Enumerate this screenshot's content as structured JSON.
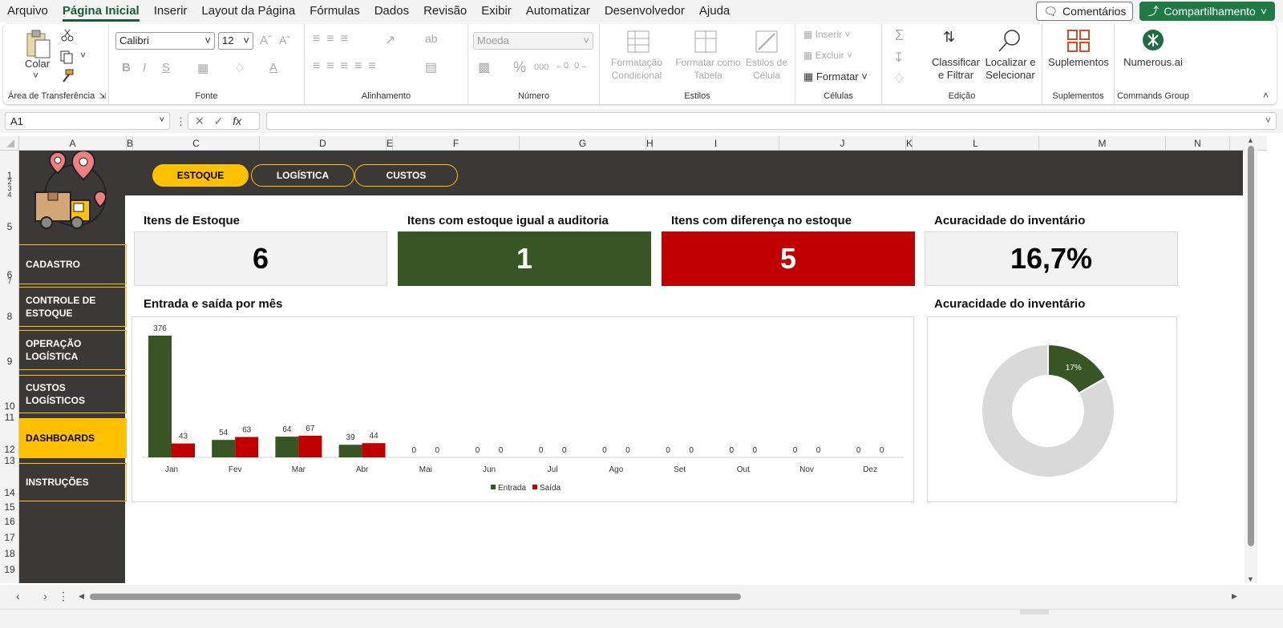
{
  "menu": {
    "tabs": [
      "Arquivo",
      "Página Inicial",
      "Inserir",
      "Layout da Página",
      "Fórmulas",
      "Dados",
      "Revisão",
      "Exibir",
      "Automatizar",
      "Desenvolvedor",
      "Ajuda"
    ],
    "comments": "Comentários",
    "share": "Compartilhamento"
  },
  "ribbon": {
    "clipboard": {
      "paste": "Colar",
      "label": "Área de Transferência"
    },
    "font": {
      "name": "Calibri",
      "size": "12",
      "label": "Fonte"
    },
    "alignment": {
      "label": "Alinhamento"
    },
    "number": {
      "format": "Moeda",
      "label": "Número"
    },
    "styles": {
      "conditional": "Formatação Condicional",
      "table": "Formatar como Tabela",
      "cell": "Estilos de Célula",
      "label": "Estilos"
    },
    "cells": {
      "insert": "Inserir",
      "delete": "Excluir",
      "format": "Formatar",
      "label": "Células"
    },
    "editing": {
      "sort": "Classificar e Filtrar",
      "find": "Localizar e Selecionar",
      "label": "Edição"
    },
    "addins": {
      "btn": "Suplementos",
      "label": "Suplementos"
    },
    "commands": {
      "btn": "Numerous.ai",
      "label": "Commands Group"
    }
  },
  "formula": {
    "namebox": "A1",
    "fx": "fx",
    "content": ""
  },
  "columns": [
    "A",
    "B",
    "C",
    "D",
    "E",
    "F",
    "G",
    "H",
    "I",
    "J",
    "K",
    "L",
    "M",
    "N"
  ],
  "rows": [
    "1",
    "2",
    "3",
    "4",
    "5",
    "6",
    "7",
    "8",
    "9",
    "10",
    "11",
    "12",
    "13",
    "14",
    "15",
    "16",
    "17",
    "18",
    "19"
  ],
  "dashboard": {
    "tabs": [
      "ESTOQUE",
      "LOGÍSTICA",
      "CUSTOS"
    ],
    "nav": [
      "CADASTRO",
      "CONTROLE DE ESTOQUE",
      "OPERAÇÃO LOGÍSTICA",
      "CUSTOS LOGÍSTICOS",
      "DASHBOARDS",
      "INSTRUÇÕES"
    ],
    "kpis": [
      {
        "title": "Itens de Estoque",
        "value": "6",
        "bg": "#f2f2f2",
        "fg": "#000000"
      },
      {
        "title": "Itens com estoque igual a auditoria",
        "value": "1",
        "bg": "#375623",
        "fg": "#ffffff"
      },
      {
        "title": "Itens com diferença no estoque",
        "value": "5",
        "bg": "#c00000",
        "fg": "#ffffff"
      },
      {
        "title": "Acuracidade do inventário",
        "value": "16,7%",
        "bg": "#f2f2f2",
        "fg": "#000000"
      }
    ],
    "bar_title": "Entrada e saída por mês",
    "donut_title": "Acuracidade do inventário"
  },
  "chart_data": [
    {
      "type": "bar",
      "title": "Entrada e saída por mês",
      "categories": [
        "Jan",
        "Fev",
        "Mar",
        "Abr",
        "Mai",
        "Jun",
        "Jul",
        "Ago",
        "Set",
        "Out",
        "Nov",
        "Dez"
      ],
      "series": [
        {
          "name": "Entrada",
          "values": [
            376,
            54,
            64,
            39,
            0,
            0,
            0,
            0,
            0,
            0,
            0,
            0
          ],
          "color": "#375623"
        },
        {
          "name": "Saída",
          "values": [
            43,
            63,
            67,
            44,
            0,
            0,
            0,
            0,
            0,
            0,
            0,
            0
          ],
          "color": "#c00000"
        }
      ],
      "ylim": [
        0,
        376
      ],
      "grid": false,
      "legend": "bottom"
    },
    {
      "type": "pie",
      "title": "Acuracidade do inventário",
      "slices": [
        {
          "label": "17%",
          "value": 16.7,
          "color": "#375623"
        },
        {
          "label": "",
          "value": 83.3,
          "color": "#d9d9d9"
        }
      ]
    }
  ],
  "colors": {
    "dark": "#3b3838",
    "accent": "#ffc000",
    "green": "#375623",
    "red": "#c00000"
  }
}
